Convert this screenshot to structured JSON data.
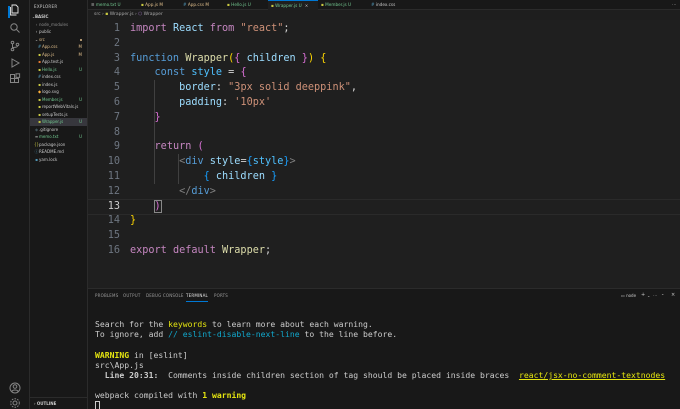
{
  "activity_icons": [
    "files-icon",
    "search-icon",
    "source-control-icon",
    "run-debug-icon",
    "extensions-icon",
    "account-icon",
    "settings-gear-icon"
  ],
  "sidebar": {
    "title": "EXPLORER",
    "root": "BASIC",
    "outline_label": "OUTLINE",
    "items": [
      {
        "label": "node_modules",
        "badge": ""
      },
      {
        "label": "public",
        "badge": ""
      },
      {
        "label": "src",
        "badge": ""
      },
      {
        "label": "App.css",
        "badge": "M"
      },
      {
        "label": "App.js",
        "badge": "M"
      },
      {
        "label": "App.test.js",
        "badge": ""
      },
      {
        "label": "Hello.js",
        "badge": "U"
      },
      {
        "label": "index.css",
        "badge": ""
      },
      {
        "label": "index.js",
        "badge": ""
      },
      {
        "label": "logo.svg",
        "badge": ""
      },
      {
        "label": "Member.js",
        "badge": "U"
      },
      {
        "label": "reportWebVitals.js",
        "badge": ""
      },
      {
        "label": "setupTests.js",
        "badge": ""
      },
      {
        "label": "Wrapper.js",
        "badge": "U"
      },
      {
        "label": ".gitignore",
        "badge": ""
      },
      {
        "label": "memo.txt",
        "badge": "U"
      },
      {
        "label": "package.json",
        "badge": ""
      },
      {
        "label": "README.md",
        "badge": ""
      },
      {
        "label": "yarn.lock",
        "badge": ""
      }
    ]
  },
  "tabs": [
    {
      "label": "memo.txt",
      "badge": "U"
    },
    {
      "label": "App.js",
      "badge": "M"
    },
    {
      "label": "App.css",
      "badge": "M"
    },
    {
      "label": "Hello.js",
      "badge": "U"
    },
    {
      "label": "Wrapper.js",
      "badge": "U"
    },
    {
      "label": "Member.js",
      "badge": "U"
    },
    {
      "label": "index.css",
      "badge": ""
    }
  ],
  "breadcrumb": [
    "src",
    "Wrapper.js",
    "Wrapper"
  ],
  "editor": {
    "line_numbers": [
      "1",
      "2",
      "3",
      "4",
      "5",
      "6",
      "7",
      "8",
      "9",
      "10",
      "11",
      "12",
      "13",
      "14",
      "15",
      "16"
    ],
    "current_line": 13
  },
  "panel": {
    "tabs": [
      "PROBLEMS",
      "OUTPUT",
      "DEBUG CONSOLE",
      "TERMINAL",
      "PORTS"
    ],
    "active_tab": "TERMINAL",
    "shell_label": "node",
    "terminal": {
      "l1_a": "Search for the ",
      "l1_kw": "keywords",
      "l1_b": " to learn more about each warning.",
      "l2_a": "To ignore, add ",
      "l2_kw": "// eslint-disable-next-line",
      "l2_b": " to the line before.",
      "l3_a": "WARNING",
      "l3_b": " in [eslint]",
      "l4": "src\\App.js",
      "l5_pos": "  Line 20:31:",
      "l5_msg": "  Comments inside children section of tag should be placed inside braces  ",
      "l5_rule": "react/jsx-no-comment-textnodes",
      "l6_a": "webpack compiled with ",
      "l6_b": "1 warning"
    }
  }
}
